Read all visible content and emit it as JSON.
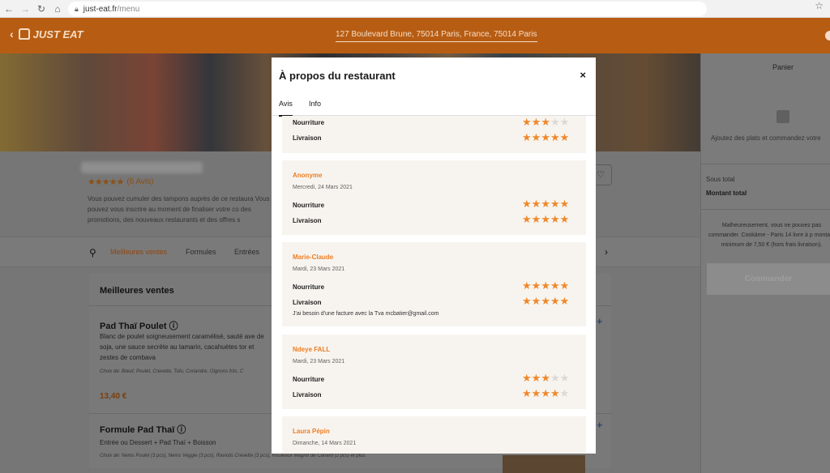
{
  "browser": {
    "back_icon": "arrow-left-icon",
    "forward_icon": "arrow-right-icon",
    "reload_icon": "reload-icon",
    "home_icon": "home-icon",
    "url_domain": "just-eat.fr",
    "url_path": "/menu"
  },
  "header": {
    "logo_text": "JUST EAT",
    "address": "127 Boulevard Brune, 75014 Paris, France, 75014 Paris",
    "brand_color": "#b75d13"
  },
  "restaurant": {
    "stars": "★★★★★",
    "reviews_count": "(6 Avis)",
    "description": "Vous pouvez cumuler des tampons auprès de ce restaura Vous pouvez vous inscrire au moment de finaliser votre co des promotions, des nouveaux restaurants et des offres s"
  },
  "categories": {
    "items": [
      "Meilleures ventes",
      "Formules",
      "Entrées"
    ]
  },
  "menu": {
    "section_title": "Meilleures ventes",
    "items": [
      {
        "title": "Pad Thaï Poulet ⓘ",
        "desc": "Blanc de poulet soigneusement caramélisé, sauté ave de soja, une sauce secrète au tamarin, cacahuètes tor et zestes de combava",
        "choice": "Choix de: Bœuf, Poulet, Crevette, Tofu, Coriandre, Oignons frits, C",
        "price": "13,40 €"
      },
      {
        "title": "Formule Pad Thaï ⓘ",
        "desc": "Entrée ou Dessert + Pad Thaï + Boisson",
        "choice": "Choix de: Nems Poulet (3 pcs), Nems Veggie (3 pcs), Raviolis Crevette (3 pcs), Rouleaux Magret de Canard (2 pcs) et plus."
      }
    ]
  },
  "cart": {
    "title": "Panier",
    "empty_text": "Ajoutez des plats et commandez votre",
    "subtotal_label": "Sous total",
    "total_label": "Montant total",
    "note": "Malheureusement, vous ne pouvez pas commander. Cookäme - Paris 14 livre à p montant minimum de 7,50 € (hors frais livraison).",
    "order_button": "Commander"
  },
  "modal": {
    "title": "À propos du restaurant",
    "close_label": "×",
    "tabs": [
      {
        "label": "Avis",
        "active": true
      },
      {
        "label": "Info",
        "active": false
      }
    ],
    "reviews": [
      {
        "author": "",
        "date": "",
        "food_label": "Nourriture",
        "food_rating": 3,
        "delivery_label": "Livraison",
        "delivery_rating": 5,
        "comment": ""
      },
      {
        "author": "Anonyme",
        "date": "Mercredi, 24 Mars 2021",
        "food_label": "Nourriture",
        "food_rating": 5,
        "delivery_label": "Livraison",
        "delivery_rating": 5,
        "comment": ""
      },
      {
        "author": "Marie-Claude",
        "date": "Mardi, 23 Mars 2021",
        "food_label": "Nourriture",
        "food_rating": 5,
        "delivery_label": "Livraison",
        "delivery_rating": 5,
        "comment": "J'ai besoin d'une facture avec la Tva mcbatier@gmail.com"
      },
      {
        "author": "Ndeye FALL",
        "date": "Mardi, 23 Mars 2021",
        "food_label": "Nourriture",
        "food_rating": 3,
        "delivery_label": "Livraison",
        "delivery_rating": 4,
        "comment": ""
      },
      {
        "author": "Laura Pépin",
        "date": "Dimanche, 14 Mars 2021",
        "food_label": "",
        "food_rating": 0,
        "delivery_label": "",
        "delivery_rating": 0,
        "comment": ""
      }
    ],
    "star_on_color": "#f0882a",
    "star_off_color": "#dcd9d4"
  }
}
